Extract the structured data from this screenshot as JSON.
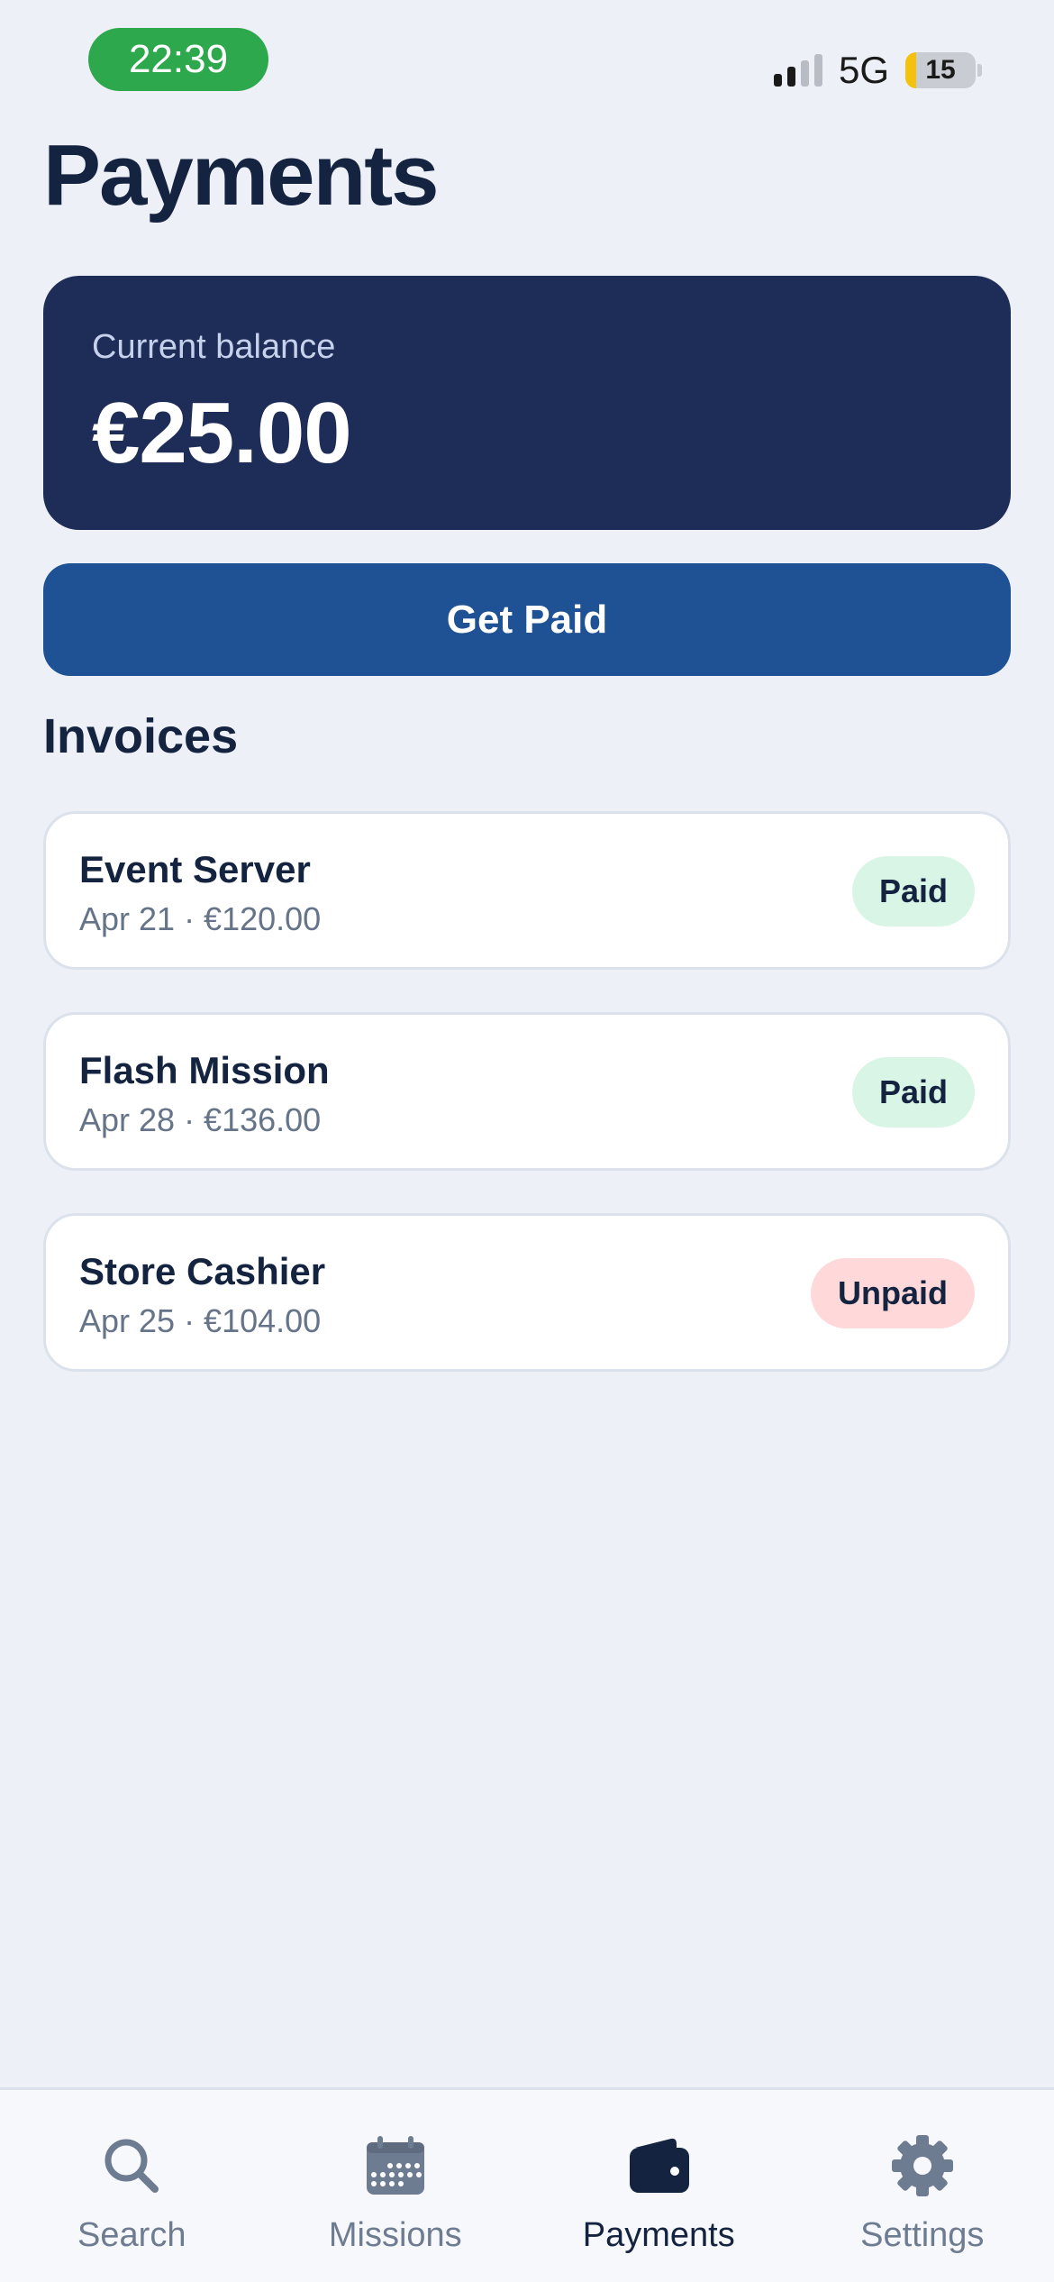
{
  "status_bar": {
    "time": "22:39",
    "network": "5G",
    "battery_level": "15",
    "battery_fraction": 0.15,
    "signal_bars_active": 2,
    "signal_bars_total": 4
  },
  "page": {
    "title": "Payments"
  },
  "balance": {
    "label": "Current balance",
    "amount": "€25.00"
  },
  "actions": {
    "get_paid_label": "Get Paid"
  },
  "invoices": {
    "section_title": "Invoices",
    "items": [
      {
        "name": "Event Server",
        "meta": "Apr 21 · €120.00",
        "status": "Paid"
      },
      {
        "name": "Flash Mission",
        "meta": "Apr 28 · €136.00",
        "status": "Paid"
      },
      {
        "name": "Store Cashier",
        "meta": "Apr 25 · €104.00",
        "status": "Unpaid"
      }
    ]
  },
  "tab_bar": {
    "items": [
      {
        "label": "Search",
        "icon": "search-icon",
        "active": false
      },
      {
        "label": "Missions",
        "icon": "calendar-icon",
        "active": false
      },
      {
        "label": "Payments",
        "icon": "wallet-icon",
        "active": true
      },
      {
        "label": "Settings",
        "icon": "gear-icon",
        "active": false
      }
    ]
  },
  "colors": {
    "background": "#EDF0F6",
    "balance_card": "#1E2D57",
    "primary_button": "#1F5195",
    "paid_badge": "#D8F5E6",
    "unpaid_badge": "#FFD9DA",
    "time_pill": "#2EA84C",
    "tab_inactive": "#6E7C91",
    "tab_active": "#14233F"
  }
}
